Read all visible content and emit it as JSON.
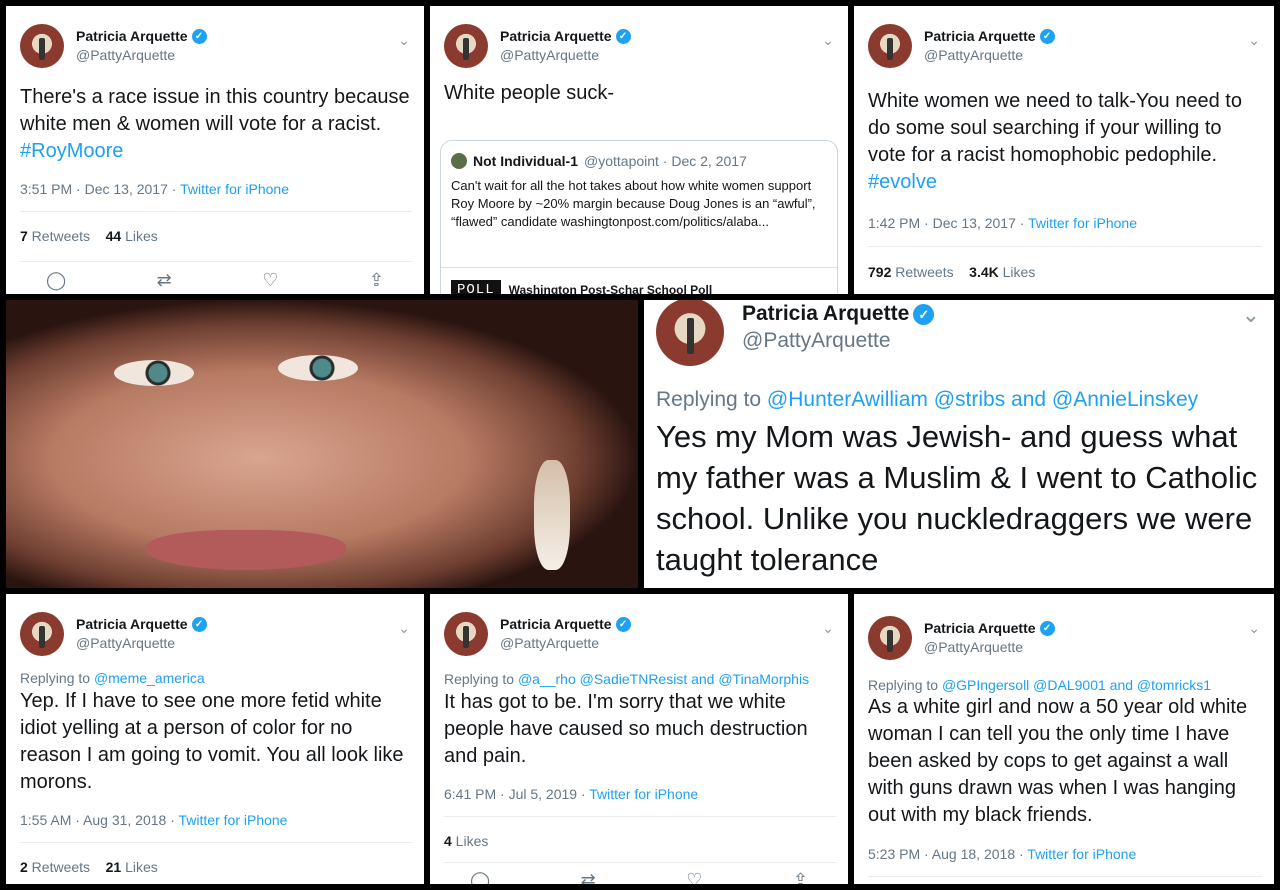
{
  "tweets": [
    {
      "name": "Patricia Arquette",
      "handle": "@PattyArquette",
      "text_before": "There's a race issue in this country because white men & women will vote for a racist. ",
      "hashtag": "#RoyMoore",
      "time": "3:51 PM · Dec 13, 2017 · ",
      "source": "Twitter for iPhone",
      "retweets": "7",
      "retweets_label": " Retweets",
      "likes": "44",
      "likes_label": " Likes"
    },
    {
      "name": "Patricia Arquette",
      "handle": "@PattyArquette",
      "text": "White people suck-",
      "quote": {
        "name": "Not Individual-1",
        "handle": "@yottapoint · Dec 2, 2017",
        "text": "Can't wait for all the hot takes about how white women support Roy Moore by ~20% margin because Doug Jones is an “awful”, “flawed” candidate washingtonpost.com/politics/alaba...",
        "poll_badge": "POLL",
        "poll_title": "Washington Post-Schar School Poll"
      }
    },
    {
      "name": "Patricia Arquette",
      "handle": "@PattyArquette",
      "text_before": "White women we need to talk-You need to do some soul searching if your willing to vote for a racist homophobic pedophile. ",
      "hashtag": "#evolve",
      "time": "1:42 PM · Dec 13, 2017 · ",
      "source": "Twitter for iPhone",
      "retweets": "792",
      "retweets_label": " Retweets",
      "likes": "3.4K",
      "likes_label": " Likes"
    },
    {
      "name": "Patricia Arquette",
      "handle": "@PattyArquette",
      "reply_prefix": "Replying to ",
      "reply_to": "@HunterAwilliam @stribs and @AnnieLinskey",
      "text": "Yes my Mom was Jewish- and guess what my father was a Muslim & I went to Catholic school. Unlike you nuckledraggers we were taught tolerance"
    },
    {
      "name": "Patricia Arquette",
      "handle": "@PattyArquette",
      "reply_prefix": "Replying to ",
      "reply_to": "@meme_america",
      "text": "Yep. If I have to see one more fetid white idiot yelling at a person of color for no reason I am going to vomit. You all look like morons.",
      "time": "1:55 AM · Aug 31, 2018 · ",
      "source": "Twitter for iPhone",
      "retweets": "2",
      "retweets_label": " Retweets",
      "likes": "21",
      "likes_label": " Likes"
    },
    {
      "name": "Patricia Arquette",
      "handle": "@PattyArquette",
      "reply_prefix": "Replying to ",
      "reply_to": "@a__rho @SadieTNResist and @TinaMorphis",
      "text": "It has got to be. I'm sorry that we white people have caused so much destruction and pain.",
      "time": "6:41 PM · Jul 5, 2019 · ",
      "source": "Twitter for iPhone",
      "likes": "4",
      "likes_label": " Likes"
    },
    {
      "name": "Patricia Arquette",
      "handle": "@PattyArquette",
      "reply_prefix": "Replying to ",
      "reply_to": "@GPIngersoll @DAL9001 and @tomricks1",
      "text": "As a white girl and now a 50 year old white woman I can tell you the only time I have been asked by cops to get against a wall with guns drawn was when I was hanging out with my black friends.",
      "time": "5:23 PM · Aug 18, 2018 · ",
      "source": "Twitter for iPhone"
    }
  ],
  "icons": {
    "verified": "✓",
    "chevron": "⌄",
    "reply": "◯",
    "retweet": "⇄",
    "like": "♡",
    "share": "⇪"
  },
  "colors": {
    "accent": "#1da1f2",
    "muted": "#657786"
  }
}
